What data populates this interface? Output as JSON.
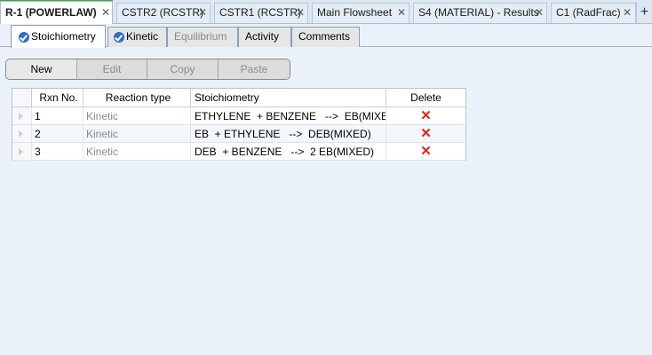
{
  "document_tabs": [
    {
      "label": "R-1 (POWERLAW)",
      "active": true
    },
    {
      "label": "CSTR2 (RCSTR)",
      "active": false
    },
    {
      "label": "CSTR1 (RCSTR)",
      "active": false
    },
    {
      "label": "Main Flowsheet",
      "active": false
    },
    {
      "label": "S4 (MATERIAL) - Results",
      "active": false
    },
    {
      "label": "C1 (RadFrac)",
      "active": false
    }
  ],
  "close_glyph": "✕",
  "new_tab_glyph": "+",
  "form_tabs": [
    {
      "label": "Stoichiometry",
      "active": true,
      "checked": true,
      "enabled": true
    },
    {
      "label": "Kinetic",
      "active": false,
      "checked": true,
      "enabled": true
    },
    {
      "label": "Equilibrium",
      "active": false,
      "checked": false,
      "enabled": false
    },
    {
      "label": "Activity",
      "active": false,
      "checked": false,
      "enabled": true
    },
    {
      "label": "Comments",
      "active": false,
      "checked": false,
      "enabled": true
    }
  ],
  "toolbar": {
    "buttons": [
      {
        "label": "New",
        "enabled": true
      },
      {
        "label": "Edit",
        "enabled": false
      },
      {
        "label": "Copy",
        "enabled": false
      },
      {
        "label": "Paste",
        "enabled": false
      }
    ]
  },
  "grid": {
    "headers": {
      "rxn_no": "Rxn No.",
      "reaction_type": "Reaction type",
      "stoichiometry": "Stoichiometry",
      "delete": "Delete"
    },
    "rows": [
      {
        "rxn_no": "1",
        "reaction_type": "Kinetic",
        "stoichiometry": "ETHYLENE  + BENZENE   -->  EB(MIXED)"
      },
      {
        "rxn_no": "2",
        "reaction_type": "Kinetic",
        "stoichiometry": "EB  + ETHYLENE   -->  DEB(MIXED)"
      },
      {
        "rxn_no": "3",
        "reaction_type": "Kinetic",
        "stoichiometry": "DEB  + BENZENE   -->  2 EB(MIXED)"
      }
    ],
    "delete_glyph": "✕"
  },
  "colors": {
    "active_tab_indicator": "#3aa839",
    "delete_icon": "#e0221b",
    "check_icon": "#2e6fc7"
  }
}
